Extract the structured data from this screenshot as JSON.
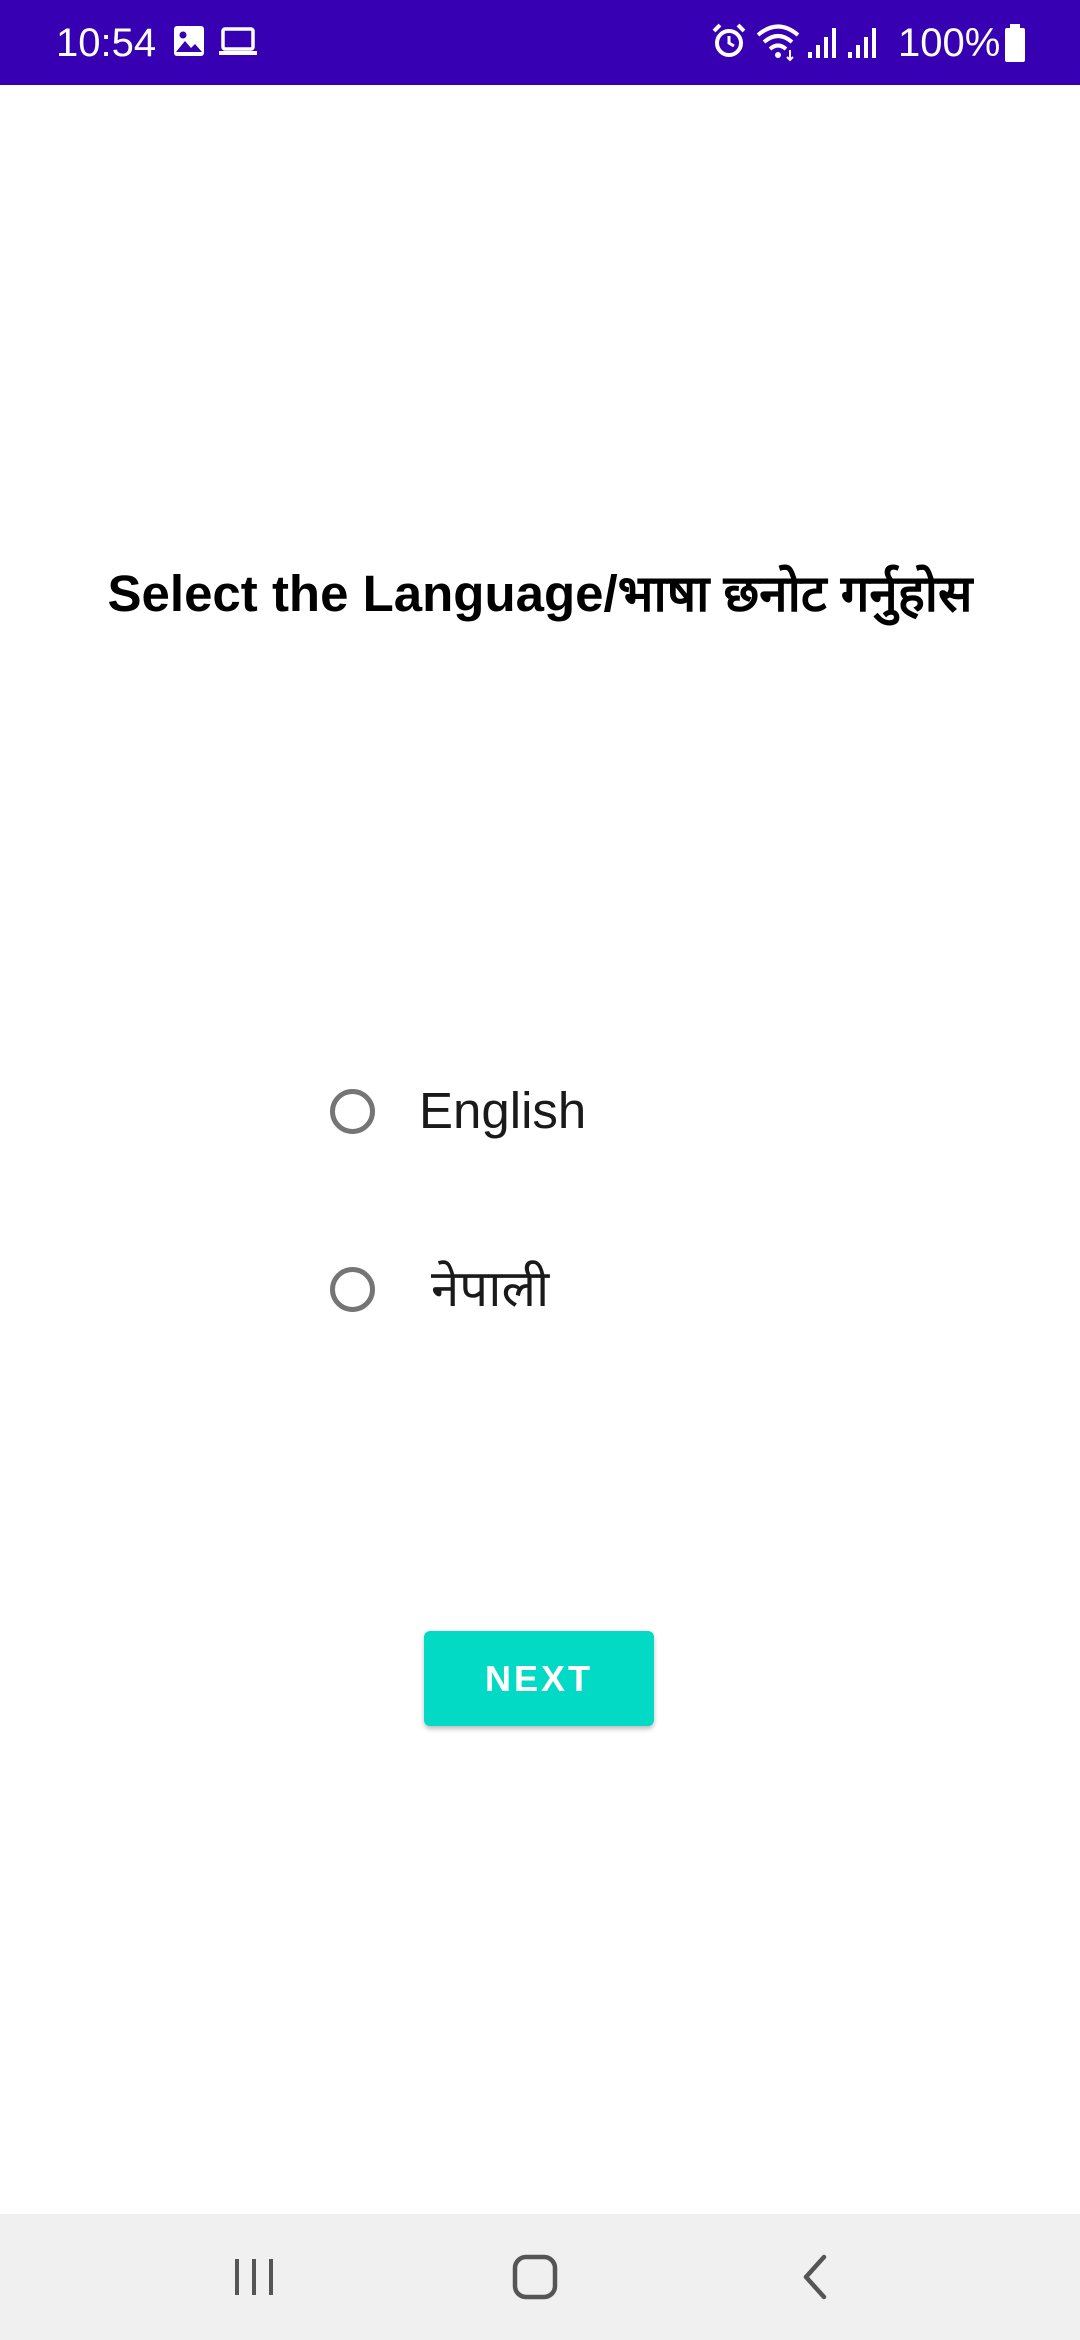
{
  "status_bar": {
    "time": "10:54",
    "battery_percent": "100%",
    "background_color": "#3700b3",
    "icons": [
      "gallery-icon",
      "laptop-icon",
      "alarm-icon",
      "wifi-icon",
      "signal-icon",
      "signal-icon",
      "battery-icon"
    ]
  },
  "screen": {
    "title": "Select the Language/भाषा छनोट गर्नुहोस",
    "options": [
      {
        "label": "English",
        "selected": false
      },
      {
        "label": "नेपाली",
        "selected": false
      }
    ],
    "next_button_label": "NEXT",
    "accent_color": "#03dac5"
  },
  "nav_bar": {
    "icons": [
      "recent-apps-icon",
      "home-icon",
      "back-icon"
    ]
  }
}
